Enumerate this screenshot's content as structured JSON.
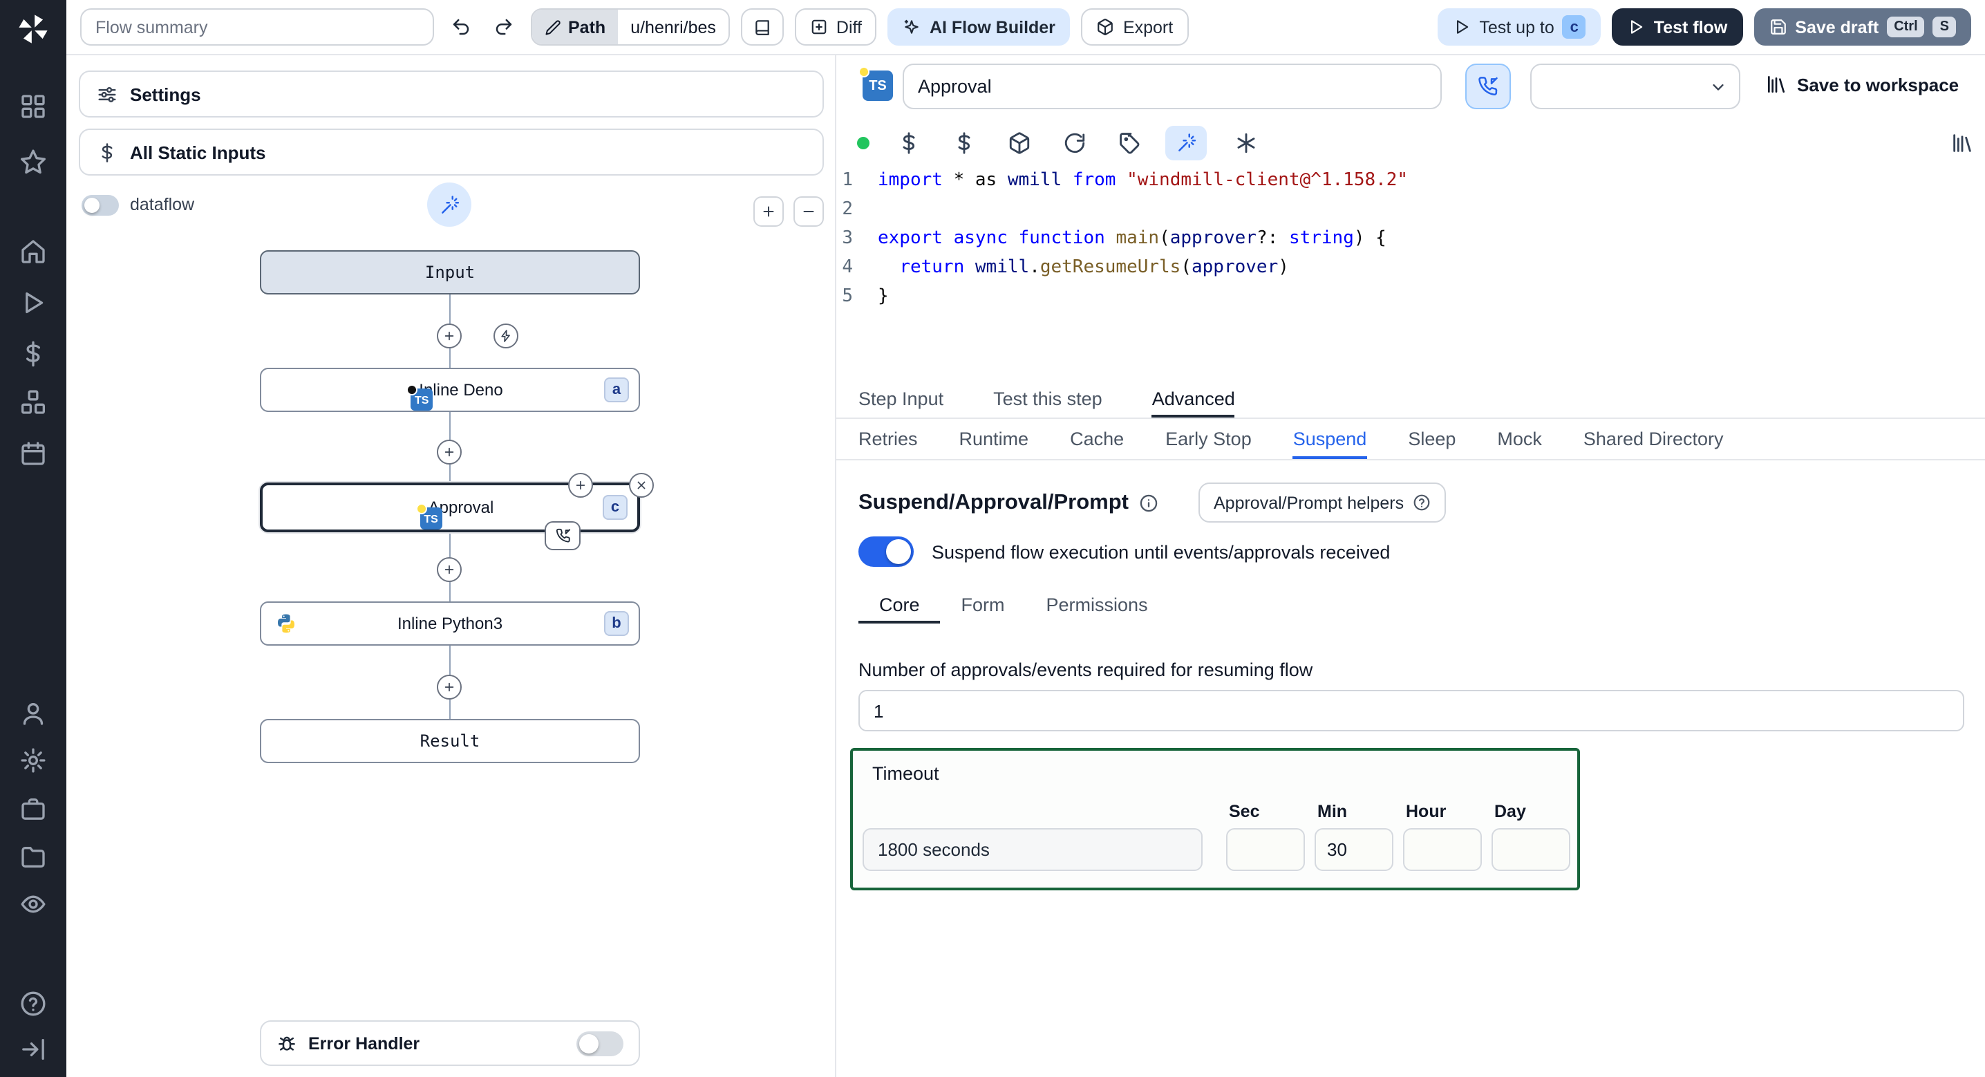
{
  "topbar": {
    "flow_summary_placeholder": "Flow summary",
    "path": {
      "label": "Path",
      "value": "u/henri/bes"
    },
    "diff_label": "Diff",
    "ai_flow_builder_label": "AI Flow Builder",
    "export_label": "Export",
    "test_up_to": {
      "label": "Test up to",
      "badge": "c"
    },
    "test_flow_label": "Test flow",
    "save_draft": {
      "label": "Save draft",
      "keys": [
        "Ctrl",
        "S"
      ]
    }
  },
  "flow_panel": {
    "settings_label": "Settings",
    "all_static_inputs_label": "All Static Inputs",
    "dataflow_label": "dataflow",
    "nodes": {
      "input": {
        "label": "Input"
      },
      "inline_deno": {
        "label": "Inline Deno",
        "badge": "a"
      },
      "approval": {
        "label": "Approval",
        "badge": "c"
      },
      "inline_python": {
        "label": "Inline Python3",
        "badge": "b"
      },
      "result": {
        "label": "Result"
      }
    },
    "error_handler_label": "Error Handler"
  },
  "step_header": {
    "language_badge": "TS",
    "name_value": "Approval",
    "save_to_workspace_label": "Save to workspace"
  },
  "editor": {
    "line_numbers": [
      "1",
      "2",
      "3",
      "4",
      "5"
    ],
    "lines": [
      [
        {
          "c": "k",
          "t": "import"
        },
        {
          "c": "d",
          "t": " * as "
        },
        {
          "c": "v",
          "t": "wmill"
        },
        {
          "c": "d",
          "t": " "
        },
        {
          "c": "k",
          "t": "from"
        },
        {
          "c": "d",
          "t": " "
        },
        {
          "c": "s",
          "t": "\"windmill-client@^1.158.2\""
        }
      ],
      [],
      [
        {
          "c": "k",
          "t": "export"
        },
        {
          "c": "d",
          "t": " "
        },
        {
          "c": "k",
          "t": "async"
        },
        {
          "c": "d",
          "t": " "
        },
        {
          "c": "k",
          "t": "function"
        },
        {
          "c": "d",
          "t": " "
        },
        {
          "c": "f",
          "t": "main"
        },
        {
          "c": "d",
          "t": "("
        },
        {
          "c": "v",
          "t": "approver"
        },
        {
          "c": "d",
          "t": "?: "
        },
        {
          "c": "k",
          "t": "string"
        },
        {
          "c": "d",
          "t": ") {"
        }
      ],
      [
        {
          "c": "d",
          "t": "  "
        },
        {
          "c": "k",
          "t": "return"
        },
        {
          "c": "d",
          "t": " "
        },
        {
          "c": "v",
          "t": "wmill"
        },
        {
          "c": "d",
          "t": "."
        },
        {
          "c": "f",
          "t": "getResumeUrls"
        },
        {
          "c": "d",
          "t": "("
        },
        {
          "c": "v",
          "t": "approver"
        },
        {
          "c": "d",
          "t": ")"
        }
      ],
      [
        {
          "c": "d",
          "t": "}"
        }
      ]
    ]
  },
  "tabs": {
    "step": [
      "Step Input",
      "Test this step",
      "Advanced"
    ],
    "advanced": [
      "Retries",
      "Runtime",
      "Cache",
      "Early Stop",
      "Suspend",
      "Sleep",
      "Mock",
      "Shared Directory"
    ]
  },
  "suspend": {
    "title": "Suspend/Approval/Prompt",
    "helpers_button_label": "Approval/Prompt helpers",
    "toggle_label": "Suspend flow execution until events/approvals received",
    "tabs": [
      "Core",
      "Form",
      "Permissions"
    ],
    "approvals_label": "Number of approvals/events required for resuming flow",
    "approvals_value": "1",
    "timeout": {
      "label": "Timeout",
      "summary_value": "1800 seconds",
      "unit_labels": [
        "Sec",
        "Min",
        "Hour",
        "Day"
      ],
      "unit_values": [
        "",
        "30",
        "",
        ""
      ]
    }
  },
  "icons": {
    "rail": [
      "windmill-logo",
      "grid",
      "star",
      "home",
      "play",
      "dollar",
      "hub",
      "calendar",
      "user",
      "settings",
      "briefcase",
      "folder",
      "eye",
      "help",
      "collapse"
    ],
    "toolbar": [
      "status-dot",
      "dollar",
      "dollar-alt",
      "package",
      "refresh",
      "tag",
      "magic-wand",
      "asterisk",
      "library"
    ]
  },
  "colors": {
    "accent_blue": "#2563eb",
    "timeout_border_green": "#17643a",
    "code_keyword": "#0000ff",
    "code_string": "#a31515"
  }
}
